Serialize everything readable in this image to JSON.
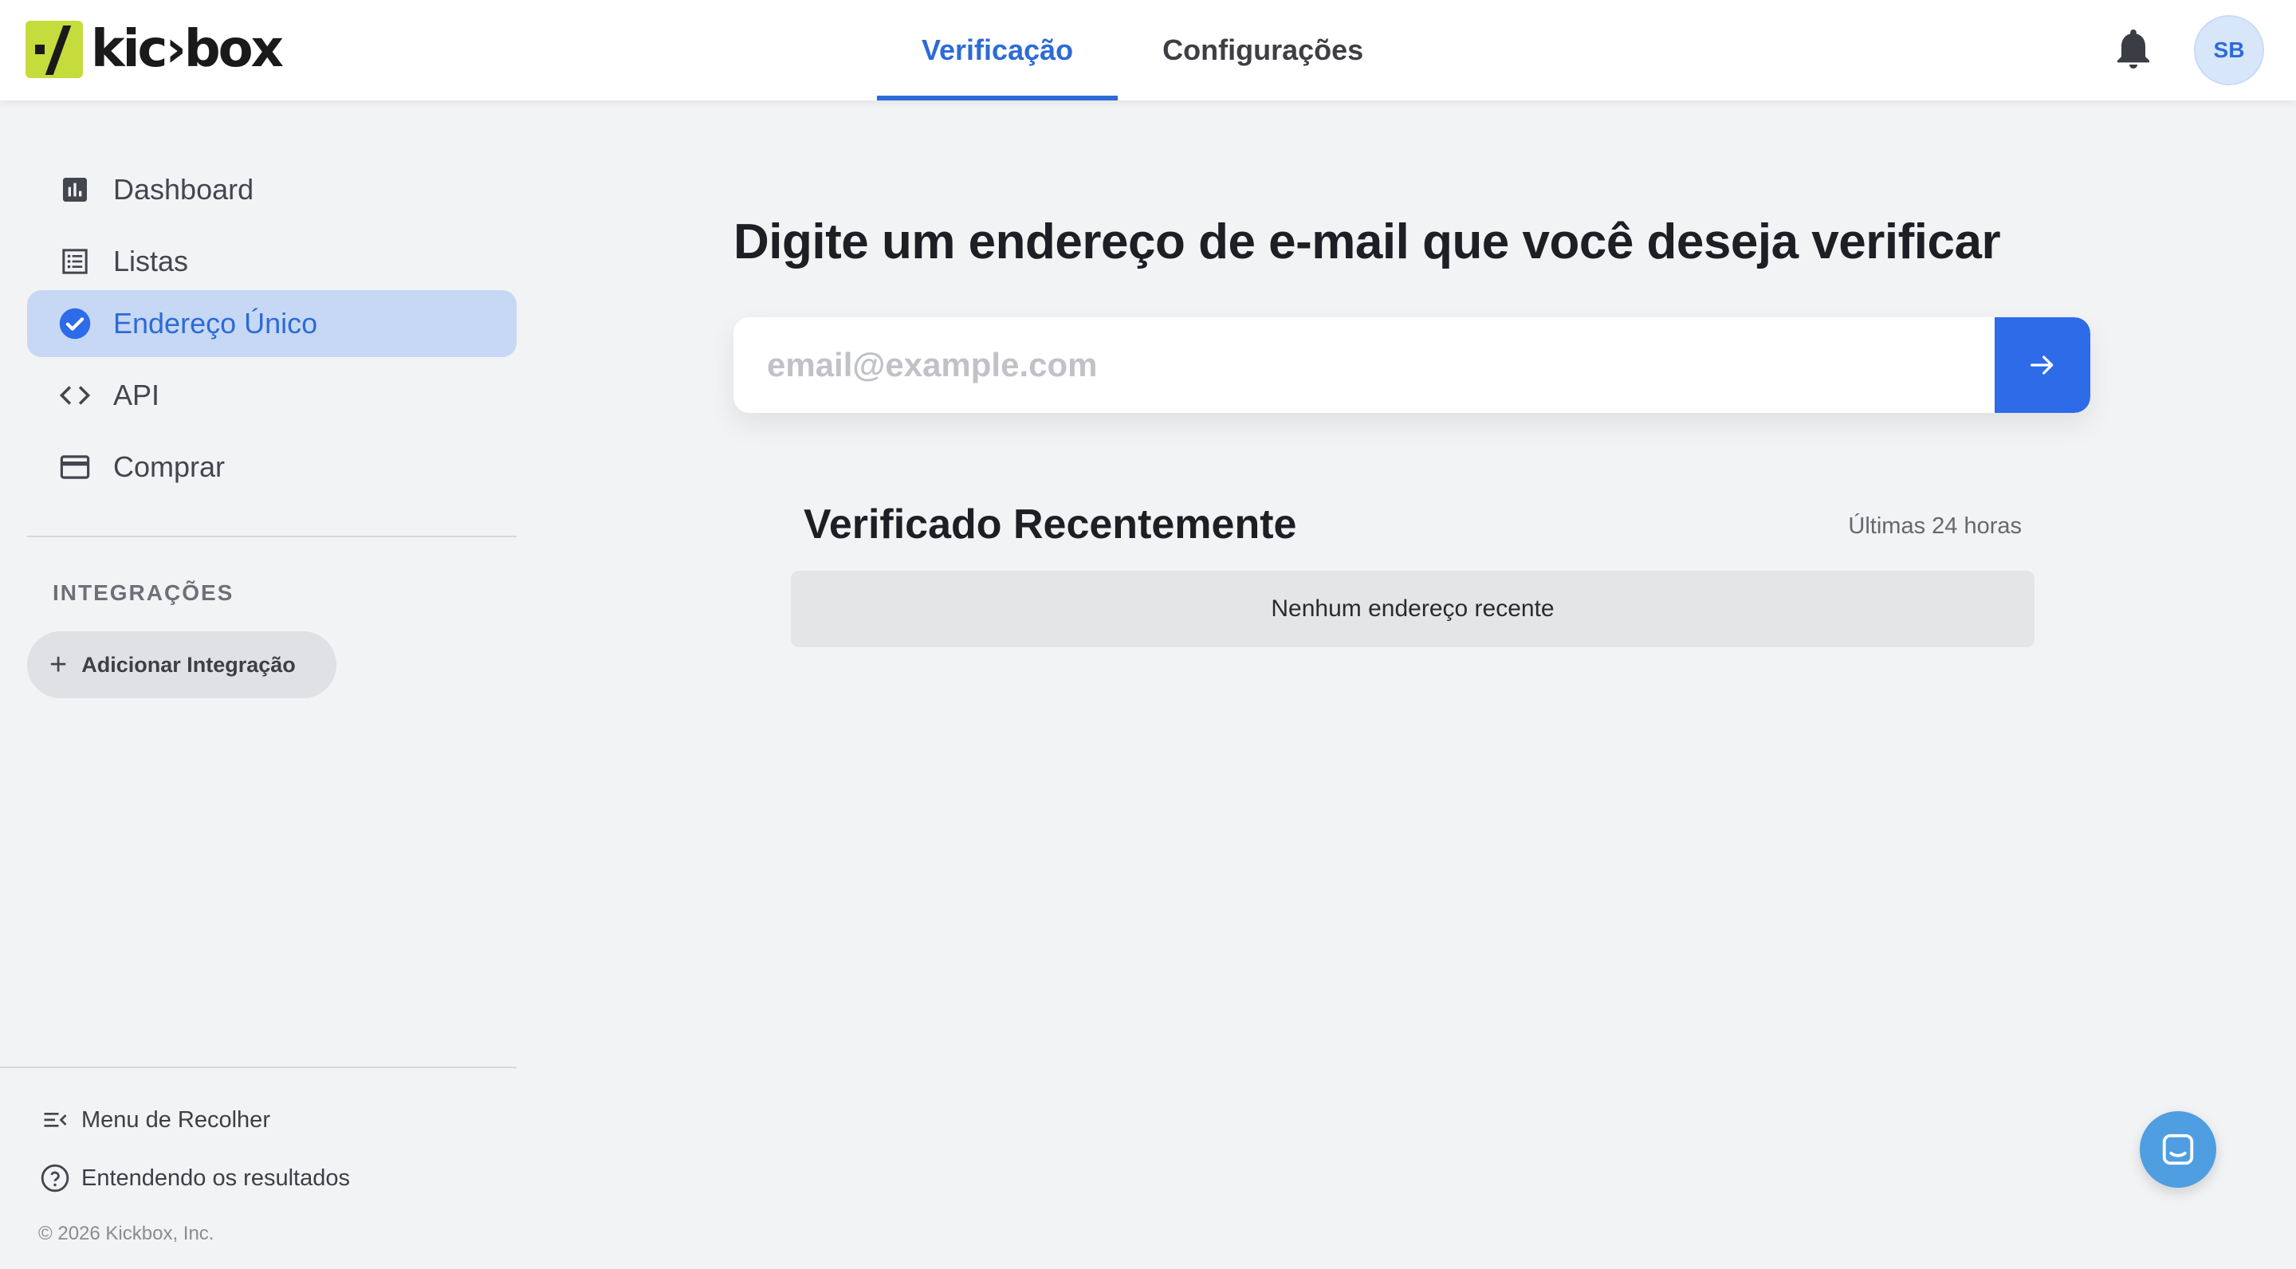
{
  "brand": {
    "name": "kickbox",
    "logo_text": "kic›box"
  },
  "header": {
    "tabs": [
      {
        "label": "Verificação",
        "active": true
      },
      {
        "label": "Configurações",
        "active": false
      }
    ],
    "avatar_initials": "SB",
    "accent_color": "#2d6bd6"
  },
  "sidebar": {
    "items": [
      {
        "label": "Dashboard",
        "icon": "bar-chart-icon",
        "active": false
      },
      {
        "label": "Listas",
        "icon": "list-icon",
        "active": false
      },
      {
        "label": "Endereço Único",
        "icon": "check-circle-icon",
        "active": true
      },
      {
        "label": "API",
        "icon": "code-icon",
        "active": false
      },
      {
        "label": "Comprar",
        "icon": "credit-card-icon",
        "active": false
      }
    ],
    "integrations_label": "INTEGRAÇÕES",
    "add_integration_label": "Adicionar Integração",
    "collapse_menu_label": "Menu de Recolher",
    "understanding_results_label": "Entendendo os resultados",
    "copyright": "© 2026 Kickbox, Inc."
  },
  "main": {
    "title": "Digite um endereço de e-mail que você deseja verificar",
    "email_input": {
      "placeholder": "email@example.com",
      "value": ""
    },
    "recent": {
      "title": "Verificado Recentemente",
      "range_label": "Últimas 24 horas",
      "empty_message": "Nenhum endereço recente"
    }
  }
}
